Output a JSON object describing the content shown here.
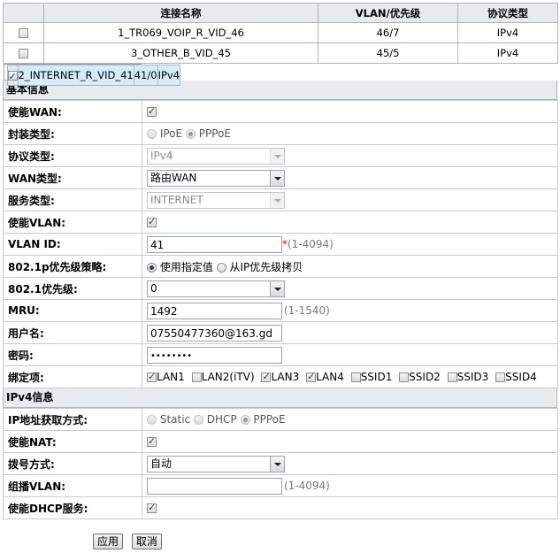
{
  "connections": {
    "headers": {
      "name": "连接名称",
      "vlan": "VLAN/优先级",
      "protocol": "协议类型"
    },
    "rows": [
      {
        "name": "1_TR069_VOIP_R_VID_46",
        "vlan": "46/7",
        "protocol": "IPv4",
        "checked": false
      },
      {
        "name": "3_OTHER_B_VID_45",
        "vlan": "45/5",
        "protocol": "IPv4",
        "checked": false
      },
      {
        "name": "2_INTERNET_R_VID_41",
        "vlan": "41/0",
        "protocol": "IPv4",
        "checked": true
      }
    ]
  },
  "basic": {
    "section_title": "基本信息",
    "enable_wan": {
      "label": "使能WAN:"
    },
    "encap": {
      "label": "封装类型:",
      "opt1": "IPoE",
      "opt2": "PPPoE"
    },
    "protocol": {
      "label": "协议类型:",
      "value": "IPv4"
    },
    "wan_type": {
      "label": "WAN类型:",
      "value": "路由WAN"
    },
    "service_type": {
      "label": "服务类型:",
      "value": "INTERNET"
    },
    "enable_vlan": {
      "label": "使能VLAN:"
    },
    "vlan_id": {
      "label": "VLAN ID:",
      "value": "41",
      "required": "*",
      "hint": "(1-4094)"
    },
    "priority_policy": {
      "label": "802.1p优先级策略:",
      "opt1": "使用指定值",
      "opt2": "从IP优先级拷贝"
    },
    "priority": {
      "label": "802.1优先级:",
      "value": "0"
    },
    "mru": {
      "label": "MRU:",
      "value": "1492",
      "hint": "(1-1540)"
    },
    "username": {
      "label": "用户名:",
      "value": "07550477360@163.gd"
    },
    "password": {
      "label": "密码:",
      "value": "••••••••"
    },
    "binding": {
      "label": "绑定项:",
      "items": [
        {
          "label": "LAN1",
          "checked": true
        },
        {
          "label": "LAN2(iTV)",
          "checked": false
        },
        {
          "label": "LAN3",
          "checked": true
        },
        {
          "label": "LAN4",
          "checked": true
        },
        {
          "label": "SSID1",
          "checked": false
        },
        {
          "label": "SSID2",
          "checked": false
        },
        {
          "label": "SSID3",
          "checked": false
        },
        {
          "label": "SSID4",
          "checked": false
        }
      ]
    }
  },
  "ipv4": {
    "section_title": "IPv4信息",
    "addr_mode": {
      "label": "IP地址获取方式:",
      "opt1": "Static",
      "opt2": "DHCP",
      "opt3": "PPPoE"
    },
    "enable_nat": {
      "label": "使能NAT:"
    },
    "dial_mode": {
      "label": "拨号方式:",
      "value": "自动"
    },
    "multicast_vlan": {
      "label": "组播VLAN:",
      "value": "",
      "hint": "(1-4094)"
    },
    "enable_dhcp": {
      "label": "使能DHCP服务:"
    }
  },
  "buttons": {
    "apply": "应用",
    "cancel": "取消"
  }
}
